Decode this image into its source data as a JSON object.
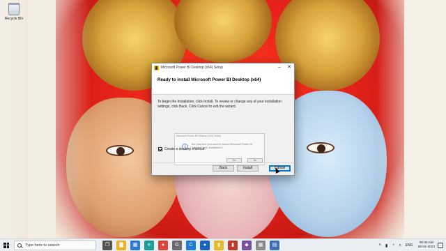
{
  "desktop": {
    "recycle_bin_label": "Recycle Bin"
  },
  "setup_window": {
    "title": "Microsoft Power BI Desktop (x64) Setup",
    "heading": "Ready to install Microsoft Power BI Desktop (x64)",
    "body_text": "To begin the installation, click Install. To review or change any of your installation settings, click Back. Click Cancel to exit the wizard.",
    "shortcut_label": "Create a desktop shortcut",
    "shortcut_checked": true,
    "buttons": {
      "back": "Back",
      "install": "Install",
      "cancel": "Cancel"
    },
    "window_controls": {
      "minimize": "–",
      "close": "✕"
    }
  },
  "confirm_dialog": {
    "title": "Microsoft Power BI Desktop (x64) Setup",
    "message": "Are you sure you want to cancel Microsoft Power BI Desktop (x64) installation?",
    "yes": "Yes",
    "no": "No"
  },
  "taskbar": {
    "search_placeholder": "Type here to search",
    "apps": [
      {
        "name": "task-view",
        "glyph": "❐",
        "color": "#555555"
      },
      {
        "name": "file-explorer",
        "glyph": "▇",
        "color": "#f2b01e"
      },
      {
        "name": "store",
        "glyph": "▦",
        "color": "#2b7bd1"
      },
      {
        "name": "edge",
        "glyph": "e",
        "color": "#1d9c9c"
      },
      {
        "name": "chrome",
        "glyph": "●",
        "color": "#db4437"
      },
      {
        "name": "app-g",
        "glyph": "G",
        "color": "#6b6b6b"
      },
      {
        "name": "app-c",
        "glyph": "C",
        "color": "#1c7cd6"
      },
      {
        "name": "app-blue",
        "glyph": "●",
        "color": "#1565c0"
      },
      {
        "name": "app-yellow",
        "glyph": "▮",
        "color": "#e8b825"
      },
      {
        "name": "app-red",
        "glyph": "▮",
        "color": "#c0392b"
      },
      {
        "name": "app-purple",
        "glyph": "◆",
        "color": "#7b4fa0"
      },
      {
        "name": "app-grey",
        "glyph": "▦",
        "color": "#8a8a8a"
      },
      {
        "name": "powerbi-setup",
        "glyph": "▤",
        "color": "#3d6fb5"
      }
    ],
    "tray": {
      "language": "ENG",
      "time": "08:30 AM",
      "date": "28-04-2023"
    }
  }
}
